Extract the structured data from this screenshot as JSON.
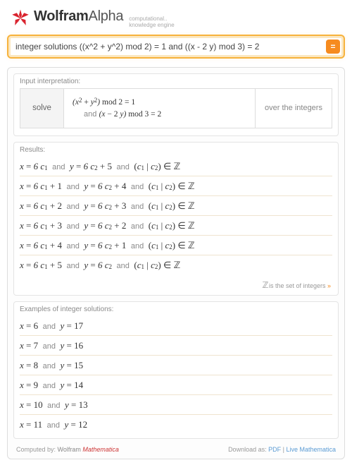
{
  "brand": {
    "name_html": "WolframAlpha",
    "tagline1": "computational..",
    "tagline2": "knowledge engine"
  },
  "search": {
    "value": "integer solutions ((x^2 + y^2) mod 2) = 1 and ((x - 2 y) mod 3) = 2",
    "submit_glyph": "="
  },
  "pods": {
    "interpretation": {
      "title": "Input interpretation:",
      "solve": "solve",
      "over": "over the integers"
    },
    "results": {
      "title": "Results:",
      "rows": [
        {
          "xk": "0",
          "yk": "5"
        },
        {
          "xk": "1",
          "yk": "4"
        },
        {
          "xk": "2",
          "yk": "3"
        },
        {
          "xk": "3",
          "yk": "2"
        },
        {
          "xk": "4",
          "yk": "1"
        },
        {
          "xk": "5",
          "yk": "0"
        }
      ],
      "footnote": " is the set of integers ",
      "footnote_chev": "»"
    },
    "examples": {
      "title": "Examples of integer solutions:",
      "rows": [
        {
          "x": "6",
          "y": "17"
        },
        {
          "x": "7",
          "y": "16"
        },
        {
          "x": "8",
          "y": "15"
        },
        {
          "x": "9",
          "y": "14"
        },
        {
          "x": "10",
          "y": "13"
        },
        {
          "x": "11",
          "y": "12"
        }
      ]
    }
  },
  "footer": {
    "computed_prefix": "Computed by: ",
    "computed_name1": "Wolfram",
    "computed_name2": "Mathematica",
    "download_prefix": "Download as: ",
    "link_pdf": "PDF",
    "link_live": "Live Mathematica",
    "sep": " | "
  }
}
